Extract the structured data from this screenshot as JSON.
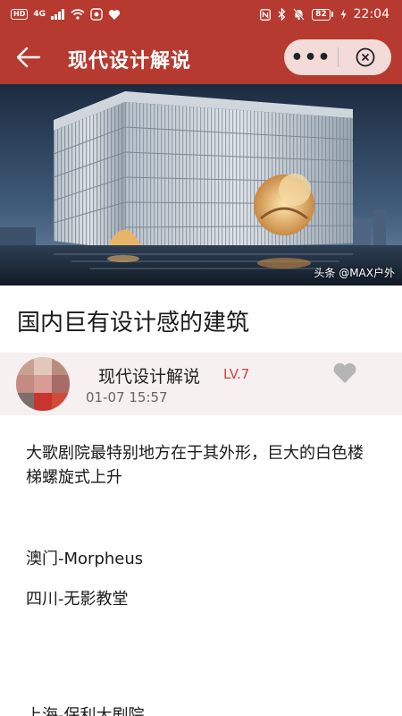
{
  "status_bar": {
    "hd": "HD",
    "signal": "4G",
    "battery": "82",
    "time": "22:04"
  },
  "header": {
    "title": "现代设计解说",
    "more": "•••"
  },
  "hero": {
    "credit": "头条 @MAX户外"
  },
  "article": {
    "title": "国内巨有设计感的建筑",
    "author": {
      "name": "现代设计解说",
      "level": "LV.7",
      "time": "01-07 15:57"
    },
    "paragraphs": [
      "大歌剧院最特别地方在于其外形，巨大的白色楼梯螺旋式上升",
      "澳门-Morpheus",
      "四川-无影教堂",
      "上海-保利大剧院"
    ]
  },
  "colors": {
    "brand_red": "#b73a30",
    "level_red": "#d0433a"
  }
}
